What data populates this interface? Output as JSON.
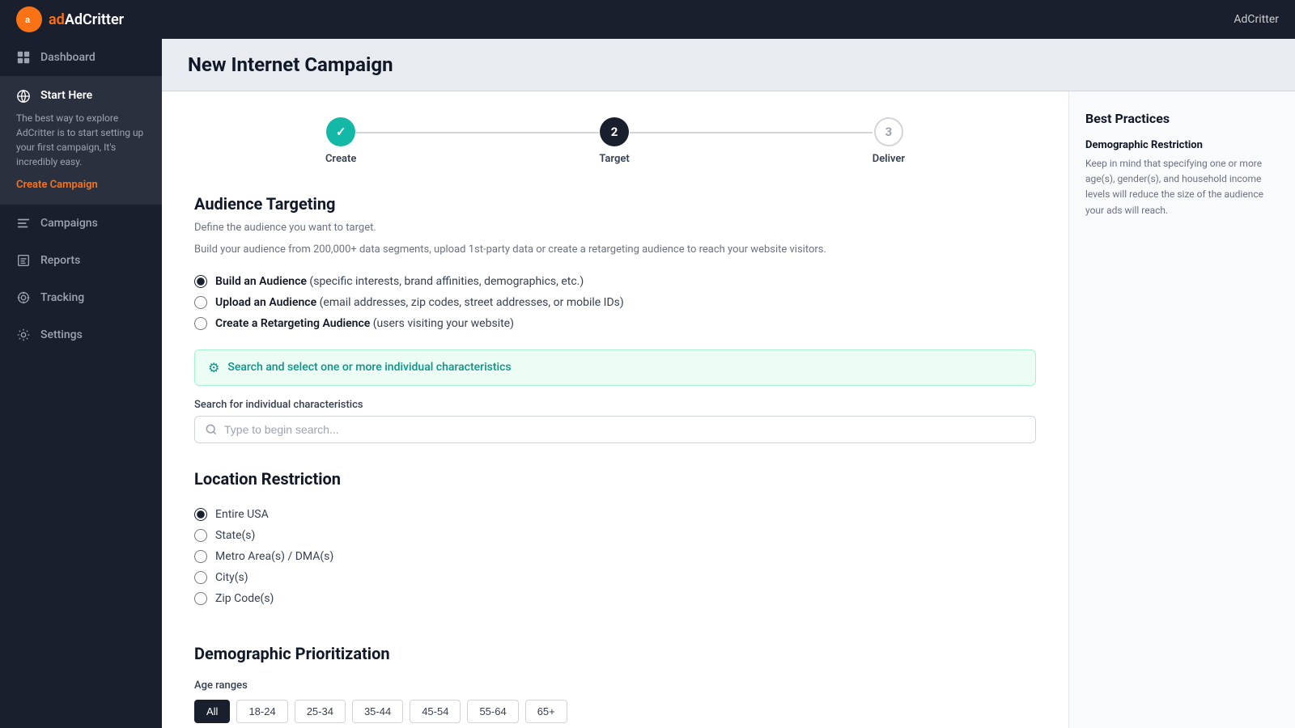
{
  "app": {
    "name": "AdCritter",
    "logo_letter": "a",
    "user_label": "AdCritter"
  },
  "sidebar": {
    "items": [
      {
        "id": "dashboard",
        "label": "Dashboard",
        "icon": "dashboard-icon"
      },
      {
        "id": "start-here",
        "label": "Start Here",
        "icon": "globe-icon",
        "active": true
      },
      {
        "id": "campaigns",
        "label": "Campaigns",
        "icon": "campaigns-icon"
      },
      {
        "id": "reports",
        "label": "Reports",
        "icon": "reports-icon"
      },
      {
        "id": "tracking",
        "label": "Tracking",
        "icon": "tracking-icon"
      },
      {
        "id": "settings",
        "label": "Settings",
        "icon": "settings-icon"
      }
    ],
    "start_here_desc": "The best way to explore AdCritter is to start setting up your first campaign, It's incredibly easy.",
    "create_campaign_label": "Create Campaign"
  },
  "page": {
    "title": "New Internet Campaign"
  },
  "stepper": {
    "steps": [
      {
        "id": "create",
        "number": "✓",
        "label": "Create",
        "state": "done"
      },
      {
        "id": "target",
        "number": "2",
        "label": "Target",
        "state": "active"
      },
      {
        "id": "deliver",
        "number": "3",
        "label": "Deliver",
        "state": "inactive"
      }
    ]
  },
  "audience_targeting": {
    "title": "Audience Targeting",
    "description1": "Define the audience you want to target.",
    "description2": "Build your audience from 200,000+ data segments, upload 1st-party data or create a retargeting audience to reach your website visitors.",
    "options": [
      {
        "id": "build",
        "label": "Build an Audience",
        "detail": "(specific interests, brand affinities, demographics, etc.)",
        "checked": true
      },
      {
        "id": "upload",
        "label": "Upload an Audience",
        "detail": "(email addresses, zip codes, street addresses, or mobile IDs)",
        "checked": false
      },
      {
        "id": "retargeting",
        "label": "Create a Retargeting Audience",
        "detail": "(users visiting your website)",
        "checked": false
      }
    ],
    "char_search_bar_text": "Search and select one or more individual characteristics",
    "search_label": "Search for individual characteristics",
    "search_placeholder": "Type to begin search..."
  },
  "location_restriction": {
    "title": "Location Restriction",
    "options": [
      {
        "id": "usa",
        "label": "Entire USA",
        "checked": true
      },
      {
        "id": "states",
        "label": "State(s)",
        "checked": false
      },
      {
        "id": "metro",
        "label": "Metro Area(s) / DMA(s)",
        "checked": false
      },
      {
        "id": "city",
        "label": "City(s)",
        "checked": false
      },
      {
        "id": "zip",
        "label": "Zip Code(s)",
        "checked": false
      }
    ]
  },
  "demographic": {
    "title": "Demographic Prioritization",
    "age_label": "Age ranges",
    "age_buttons": [
      {
        "id": "all",
        "label": "All",
        "active": true
      },
      {
        "id": "18-24",
        "label": "18-24",
        "active": false
      },
      {
        "id": "25-34",
        "label": "25-34",
        "active": false
      },
      {
        "id": "35-44",
        "label": "35-44",
        "active": false
      },
      {
        "id": "45-54",
        "label": "45-54",
        "active": false
      },
      {
        "id": "55-64",
        "label": "55-64",
        "active": false
      },
      {
        "id": "65+",
        "label": "65+",
        "active": false
      }
    ]
  },
  "best_practices": {
    "title": "Best Practices",
    "items": [
      {
        "title": "Demographic Restriction",
        "text": "Keep in mind that specifying one or more age(s), gender(s), and household income levels will reduce the size of the audience your ads will reach."
      }
    ]
  }
}
